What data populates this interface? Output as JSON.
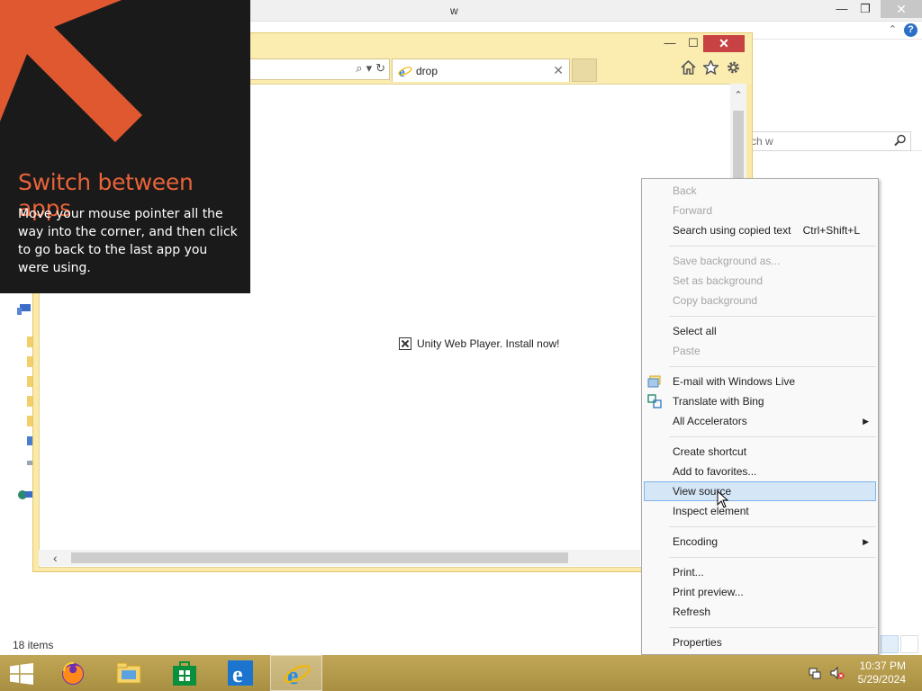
{
  "explorer": {
    "title_fragment": "w",
    "search_placeholder": "rch w",
    "status": "18 items",
    "minimize_glyph": "—",
    "maximize_glyph": "❐",
    "close_glyph": "✕",
    "chevron_glyph": "⌃",
    "help_glyph": "?"
  },
  "browser": {
    "tab_title": "drop",
    "tab_close": "✕",
    "minimize_glyph": "—",
    "maximize_glyph": "☐",
    "close_glyph": "✕",
    "search_glyph": "⌕",
    "dropdown_glyph": "▾",
    "refresh_glyph": "↻",
    "page_message": "Unity Web Player. Install now!",
    "scroll_up_glyph": "⌃",
    "scroll_left_glyph": "‹"
  },
  "charm_hint": {
    "title": "Switch between apps",
    "body": "Move your mouse pointer all the way into the corner, and then click to go back to the last app you were using.",
    "accent_color": "#e8633a"
  },
  "context_menu": {
    "items": [
      {
        "label": "Back",
        "disabled": true
      },
      {
        "label": "Forward",
        "disabled": true
      },
      {
        "label": "Search using copied text",
        "shortcut": "Ctrl+Shift+L"
      },
      {
        "label": "Save background as...",
        "disabled": true
      },
      {
        "label": "Set as background",
        "disabled": true
      },
      {
        "label": "Copy background",
        "disabled": true
      },
      {
        "label": "Select all"
      },
      {
        "label": "Paste",
        "disabled": true
      },
      {
        "label": "E-mail with Windows Live",
        "icon": "windows-live-mail-icon"
      },
      {
        "label": "Translate with Bing",
        "icon": "bing-translate-icon"
      },
      {
        "label": "All Accelerators",
        "submenu": true
      },
      {
        "label": "Create shortcut"
      },
      {
        "label": "Add to favorites..."
      },
      {
        "label": "View source",
        "hover": true
      },
      {
        "label": "Inspect element"
      },
      {
        "label": "Encoding",
        "submenu": true
      },
      {
        "label": "Print..."
      },
      {
        "label": "Print preview..."
      },
      {
        "label": "Refresh"
      },
      {
        "label": "Properties"
      }
    ],
    "submenu_glyph": "▶",
    "hover_color": "#d5e6f7"
  },
  "taskbar": {
    "apps": [
      "firefox-icon",
      "file-explorer-icon",
      "store-icon",
      "internet-explorer-icon",
      "internet-explorer-icon"
    ],
    "time": "10:37 PM",
    "date": "5/29/2024",
    "color": "#b1974a"
  }
}
